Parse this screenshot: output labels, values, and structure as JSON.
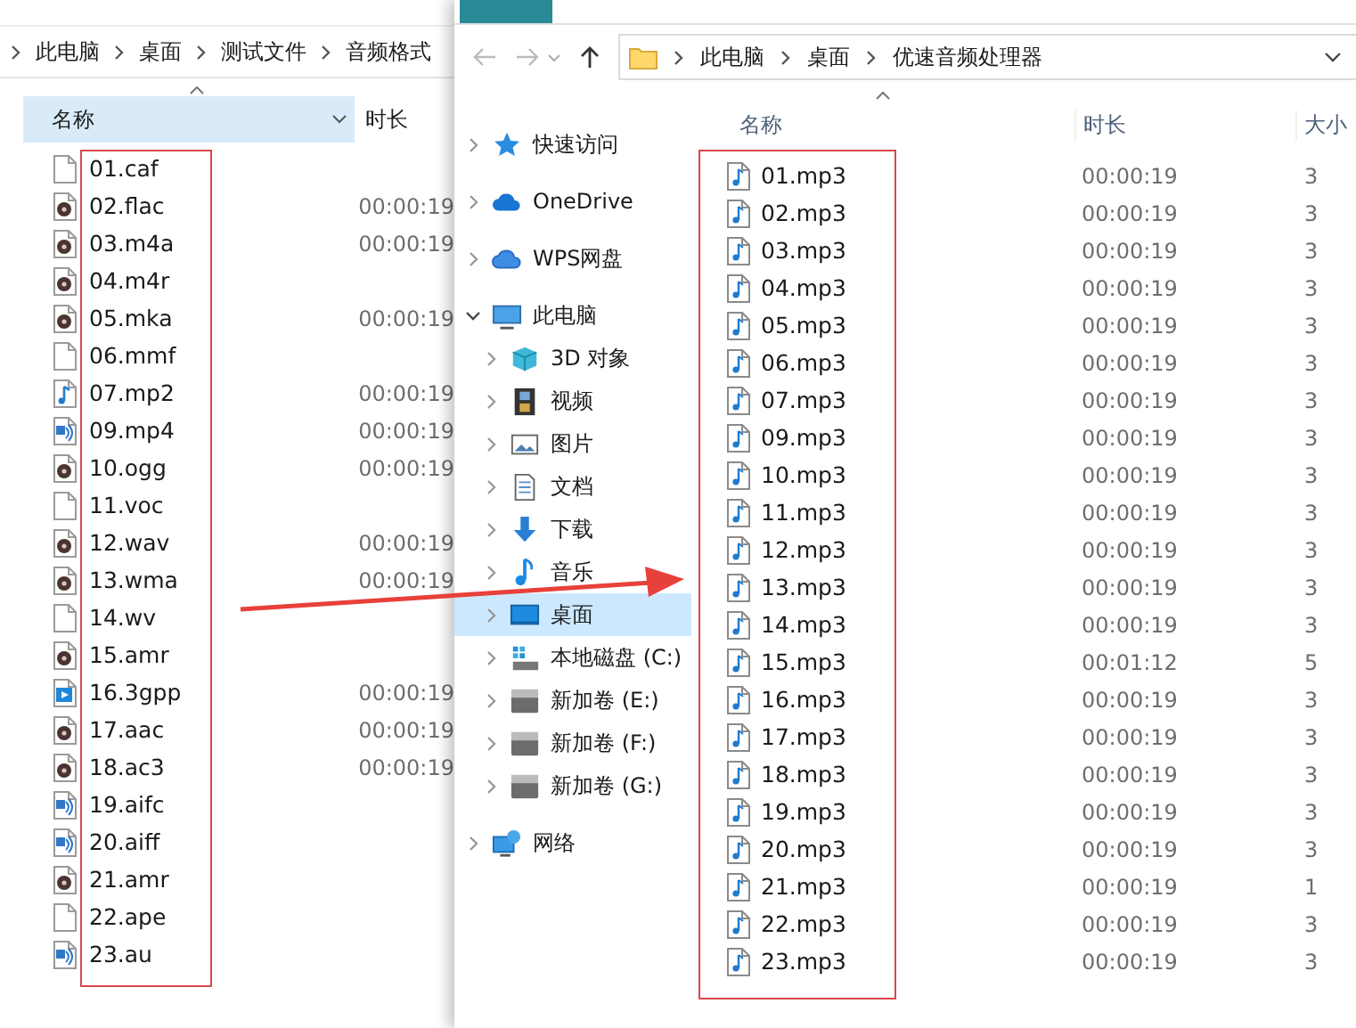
{
  "back_window": {
    "breadcrumb": [
      "此电脑",
      "桌面",
      "测试文件",
      "音频格式"
    ],
    "columns": [
      {
        "label": "名称",
        "selected": true
      },
      {
        "label": "时长",
        "selected": false
      }
    ],
    "files": [
      {
        "name": "01.caf",
        "kind": "blank"
      },
      {
        "name": "02.flac",
        "kind": "media",
        "duration": "00:00:19"
      },
      {
        "name": "03.m4a",
        "kind": "media",
        "duration": "00:00:19"
      },
      {
        "name": "04.m4r",
        "kind": "media"
      },
      {
        "name": "05.mka",
        "kind": "media",
        "duration": "00:00:19"
      },
      {
        "name": "06.mmf",
        "kind": "blank"
      },
      {
        "name": "07.mp2",
        "kind": "note",
        "duration": "00:00:19"
      },
      {
        "name": "09.mp4",
        "kind": "audio",
        "duration": "00:00:19"
      },
      {
        "name": "10.ogg",
        "kind": "media",
        "duration": "00:00:19"
      },
      {
        "name": "11.voc",
        "kind": "blank"
      },
      {
        "name": "12.wav",
        "kind": "media",
        "duration": "00:00:19"
      },
      {
        "name": "13.wma",
        "kind": "media",
        "duration": "00:00:19"
      },
      {
        "name": "14.wv",
        "kind": "blank"
      },
      {
        "name": "15.amr",
        "kind": "media"
      },
      {
        "name": "16.3gpp",
        "kind": "video",
        "duration": "00:00:19"
      },
      {
        "name": "17.aac",
        "kind": "media",
        "duration": "00:00:19"
      },
      {
        "name": "18.ac3",
        "kind": "media",
        "duration": "00:00:19"
      },
      {
        "name": "19.aifc",
        "kind": "audio"
      },
      {
        "name": "20.aiff",
        "kind": "audio"
      },
      {
        "name": "21.amr",
        "kind": "media"
      },
      {
        "name": "22.ape",
        "kind": "blank"
      },
      {
        "name": "23.au",
        "kind": "audio"
      }
    ]
  },
  "front_window": {
    "address": [
      "此电脑",
      "桌面",
      "优速音频处理器"
    ],
    "nav": [
      {
        "label": "快速访问",
        "kind": "star",
        "selected": false,
        "expanded": false
      },
      {
        "label": "OneDrive",
        "kind": "cloud",
        "selected": false,
        "expanded": false
      },
      {
        "label": "WPS网盘",
        "kind": "cloud2",
        "selected": false,
        "expanded": false
      },
      {
        "label": "此电脑",
        "kind": "pc",
        "selected": false,
        "expanded": true,
        "children": [
          {
            "label": "3D 对象",
            "kind": "cube",
            "selected": false,
            "expanded": false
          },
          {
            "label": "视频",
            "kind": "film",
            "selected": false,
            "expanded": false
          },
          {
            "label": "图片",
            "kind": "picture",
            "selected": false,
            "expanded": false
          },
          {
            "label": "文档",
            "kind": "doc",
            "selected": false,
            "expanded": false
          },
          {
            "label": "下载",
            "kind": "download",
            "selected": false,
            "expanded": false
          },
          {
            "label": "音乐",
            "kind": "music",
            "selected": false,
            "expanded": false
          },
          {
            "label": "桌面",
            "kind": "desktop",
            "selected": true,
            "expanded": false
          },
          {
            "label": "本地磁盘 (C:)",
            "kind": "sysdrive",
            "selected": false,
            "expanded": false
          },
          {
            "label": "新加卷 (E:)",
            "kind": "drive",
            "selected": false,
            "expanded": false
          },
          {
            "label": "新加卷 (F:)",
            "kind": "drive",
            "selected": false,
            "expanded": false
          },
          {
            "label": "新加卷 (G:)",
            "kind": "drive",
            "selected": false,
            "expanded": false
          }
        ]
      },
      {
        "label": "网络",
        "kind": "network",
        "selected": false,
        "expanded": false
      }
    ],
    "columns": [
      "名称",
      "时长",
      "大小"
    ],
    "files": [
      {
        "name": "01.mp3",
        "duration": "00:00:19",
        "column_3": "3"
      },
      {
        "name": "02.mp3",
        "duration": "00:00:19",
        "column_3": "3"
      },
      {
        "name": "03.mp3",
        "duration": "00:00:19",
        "column_3": "3"
      },
      {
        "name": "04.mp3",
        "duration": "00:00:19",
        "column_3": "3"
      },
      {
        "name": "05.mp3",
        "duration": "00:00:19",
        "column_3": "3"
      },
      {
        "name": "06.mp3",
        "duration": "00:00:19",
        "column_3": "3"
      },
      {
        "name": "07.mp3",
        "duration": "00:00:19",
        "column_3": "3"
      },
      {
        "name": "09.mp3",
        "duration": "00:00:19",
        "column_3": "3"
      },
      {
        "name": "10.mp3",
        "duration": "00:00:19",
        "column_3": "3"
      },
      {
        "name": "11.mp3",
        "duration": "00:00:19",
        "column_3": "3"
      },
      {
        "name": "12.mp3",
        "duration": "00:00:19",
        "column_3": "3"
      },
      {
        "name": "13.mp3",
        "duration": "00:00:19",
        "column_3": "3"
      },
      {
        "name": "14.mp3",
        "duration": "00:00:19",
        "column_3": "3"
      },
      {
        "name": "15.mp3",
        "duration": "00:01:12",
        "column_3": "5"
      },
      {
        "name": "16.mp3",
        "duration": "00:00:19",
        "column_3": "3"
      },
      {
        "name": "17.mp3",
        "duration": "00:00:19",
        "column_3": "3"
      },
      {
        "name": "18.mp3",
        "duration": "00:00:19",
        "column_3": "3"
      },
      {
        "name": "19.mp3",
        "duration": "00:00:19",
        "column_3": "3"
      },
      {
        "name": "20.mp3",
        "duration": "00:00:19",
        "column_3": "3"
      },
      {
        "name": "21.mp3",
        "duration": "00:00:19",
        "column_3": "1"
      },
      {
        "name": "22.mp3",
        "duration": "00:00:19",
        "column_3": "3"
      },
      {
        "name": "23.mp3",
        "duration": "00:00:19",
        "column_3": "3"
      }
    ]
  }
}
